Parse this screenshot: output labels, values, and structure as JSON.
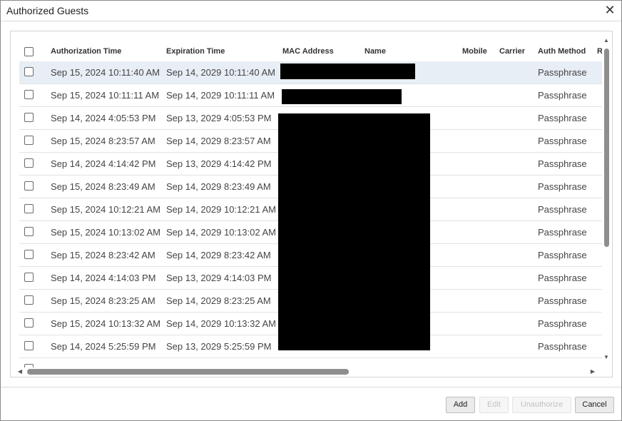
{
  "dialog": {
    "title": "Authorized Guests",
    "close_icon": "close-icon"
  },
  "table": {
    "columns": [
      "Authorization Time",
      "Expiration Time",
      "MAC Address",
      "Name",
      "Mobile",
      "Carrier",
      "Auth Method",
      "R"
    ],
    "rows": [
      {
        "auth": "Sep 15, 2024 10:11:40 AM",
        "exp": "Sep 14, 2029 10:11:40 AM",
        "method": "Passphrase"
      },
      {
        "auth": "Sep 15, 2024 10:11:11 AM",
        "exp": "Sep 14, 2029 10:11:11 AM",
        "method": "Passphrase"
      },
      {
        "auth": "Sep 14, 2024 4:05:53 PM",
        "exp": "Sep 13, 2029 4:05:53 PM",
        "method": "Passphrase"
      },
      {
        "auth": "Sep 15, 2024 8:23:57 AM",
        "exp": "Sep 14, 2029 8:23:57 AM",
        "method": "Passphrase"
      },
      {
        "auth": "Sep 14, 2024 4:14:42 PM",
        "exp": "Sep 13, 2029 4:14:42 PM",
        "method": "Passphrase"
      },
      {
        "auth": "Sep 15, 2024 8:23:49 AM",
        "exp": "Sep 14, 2029 8:23:49 AM",
        "method": "Passphrase"
      },
      {
        "auth": "Sep 15, 2024 10:12:21 AM",
        "exp": "Sep 14, 2029 10:12:21 AM",
        "method": "Passphrase"
      },
      {
        "auth": "Sep 15, 2024 10:13:02 AM",
        "exp": "Sep 14, 2029 10:13:02 AM",
        "method": "Passphrase"
      },
      {
        "auth": "Sep 15, 2024 8:23:42 AM",
        "exp": "Sep 14, 2029 8:23:42 AM",
        "method": "Passphrase"
      },
      {
        "auth": "Sep 14, 2024 4:14:03 PM",
        "exp": "Sep 13, 2029 4:14:03 PM",
        "method": "Passphrase"
      },
      {
        "auth": "Sep 15, 2024 8:23:25 AM",
        "exp": "Sep 14, 2029 8:23:25 AM",
        "method": "Passphrase"
      },
      {
        "auth": "Sep 15, 2024 10:13:32 AM",
        "exp": "Sep 14, 2029 10:13:32 AM",
        "method": "Passphrase"
      },
      {
        "auth": "Sep 14, 2024 5:25:59 PM",
        "exp": "Sep 13, 2029 5:25:59 PM",
        "method": "Passphrase"
      },
      {
        "auth": "",
        "exp": "",
        "method": ""
      }
    ]
  },
  "footer": {
    "add_label": "Add",
    "edit_label": "Edit",
    "unauthorize_label": "Unauthorize",
    "cancel_label": "Cancel"
  },
  "colors": {
    "selected_row": "#e8eef5",
    "redaction": "#000000"
  }
}
